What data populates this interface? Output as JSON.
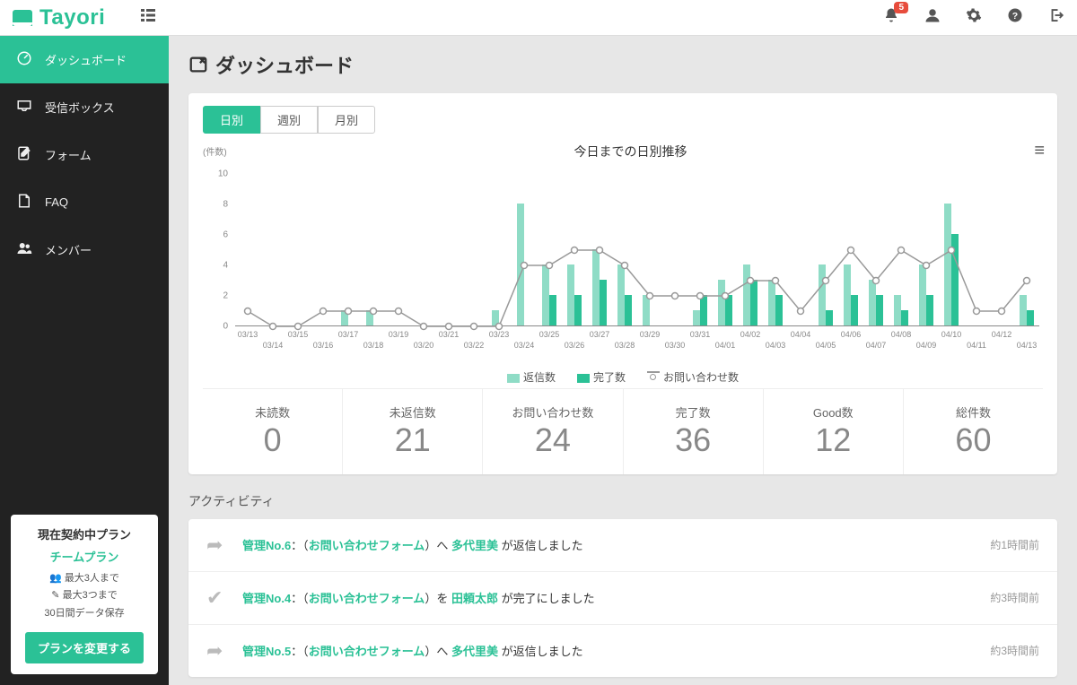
{
  "brand": "Tayori",
  "notification_count": "5",
  "sidebar": {
    "items": [
      {
        "label": "ダッシュボード",
        "icon": "dashboard"
      },
      {
        "label": "受信ボックス",
        "icon": "inbox"
      },
      {
        "label": "フォーム",
        "icon": "form"
      },
      {
        "label": "FAQ",
        "icon": "faq"
      },
      {
        "label": "メンバー",
        "icon": "members"
      }
    ],
    "plan": {
      "title": "現在契約中プラン",
      "name": "チームプラン",
      "limit_users": "最大3人まで",
      "limit_forms": "最大3つまで",
      "retention": "30日間データ保存",
      "button": "プランを変更する"
    }
  },
  "page": {
    "title": "ダッシュボード"
  },
  "tabs": [
    {
      "label": "日別"
    },
    {
      "label": "週別"
    },
    {
      "label": "月別"
    }
  ],
  "chart_data": {
    "type": "bar+line",
    "title": "今日までの日別推移",
    "unit_label": "(件数)",
    "ylim": [
      0,
      10
    ],
    "yticks": [
      0,
      2,
      4,
      6,
      8,
      10
    ],
    "categories": [
      "03/13",
      "03/14",
      "03/15",
      "03/16",
      "03/17",
      "03/18",
      "03/19",
      "03/20",
      "03/21",
      "03/22",
      "03/23",
      "03/24",
      "03/25",
      "03/26",
      "03/27",
      "03/28",
      "03/29",
      "03/30",
      "03/31",
      "04/01",
      "04/02",
      "04/03",
      "04/04",
      "04/05",
      "04/06",
      "04/07",
      "04/08",
      "04/09",
      "04/10",
      "04/11",
      "04/12",
      "04/13"
    ],
    "series": [
      {
        "name": "返信数",
        "type": "bar",
        "color": "#8fdcc6",
        "values": [
          0,
          0,
          0,
          0,
          1,
          1,
          0,
          0,
          0,
          0,
          1,
          8,
          4,
          4,
          5,
          4,
          2,
          0,
          1,
          3,
          4,
          3,
          0,
          4,
          4,
          3,
          2,
          4,
          8,
          0,
          0,
          2
        ]
      },
      {
        "name": "完了数",
        "type": "bar",
        "color": "#2bc196",
        "values": [
          0,
          0,
          0,
          0,
          0,
          0,
          0,
          0,
          0,
          0,
          0,
          0,
          2,
          2,
          3,
          2,
          0,
          0,
          2,
          2,
          3,
          2,
          0,
          1,
          2,
          2,
          1,
          2,
          6,
          0,
          0,
          1
        ]
      },
      {
        "name": "お問い合わせ数",
        "type": "line",
        "color": "#999999",
        "values": [
          1,
          0,
          0,
          1,
          1,
          1,
          1,
          0,
          0,
          0,
          0,
          4,
          4,
          5,
          5,
          4,
          2,
          2,
          2,
          2,
          3,
          3,
          1,
          3,
          5,
          3,
          5,
          4,
          5,
          1,
          1,
          3
        ]
      }
    ],
    "legend": [
      "返信数",
      "完了数",
      "お問い合わせ数"
    ]
  },
  "stats": [
    {
      "label": "未読数",
      "value": "0"
    },
    {
      "label": "未返信数",
      "value": "21"
    },
    {
      "label": "お問い合わせ数",
      "value": "24"
    },
    {
      "label": "完了数",
      "value": "36"
    },
    {
      "label": "Good数",
      "value": "12"
    },
    {
      "label": "総件数",
      "value": "60"
    }
  ],
  "activity": {
    "title": "アクティビティ",
    "items": [
      {
        "icon": "reply",
        "mgmt": "管理No.6",
        "sep": "：（",
        "form": "お問い合わせフォーム",
        "mid": "）へ ",
        "user": "多代里美",
        "tail": " が返信しました",
        "time": "約1時間前"
      },
      {
        "icon": "done",
        "mgmt": "管理No.4",
        "sep": "：（",
        "form": "お問い合わせフォーム",
        "mid": "）を ",
        "user": "田頼太郎",
        "tail": " が完了にしました",
        "time": "約3時間前"
      },
      {
        "icon": "reply",
        "mgmt": "管理No.5",
        "sep": "：（",
        "form": "お問い合わせフォーム",
        "mid": "）へ ",
        "user": "多代里美",
        "tail": " が返信しました",
        "time": "約3時間前"
      }
    ]
  }
}
